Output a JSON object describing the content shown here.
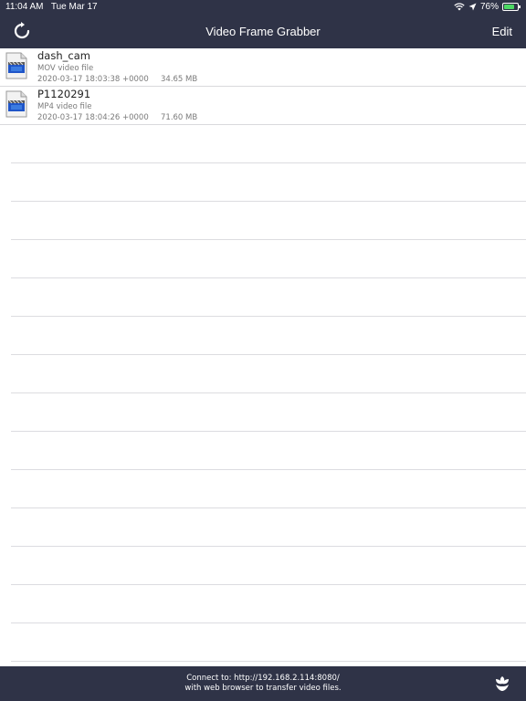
{
  "status": {
    "time": "11:04 AM",
    "date": "Tue Mar 17",
    "battery": "76%",
    "battery_level": 0.76
  },
  "nav": {
    "title": "Video Frame Grabber",
    "edit_label": "Edit"
  },
  "files": [
    {
      "name": "dash_cam",
      "kind": "MOV video file",
      "date": "2020-03-17 18:03:38 +0000",
      "size": "34.65 MB"
    },
    {
      "name": "P1120291",
      "kind": "MP4 video file",
      "date": "2020-03-17 18:04:26 +0000",
      "size": "71.60 MB"
    }
  ],
  "footer": {
    "line1": "Connect to: http://192.168.2.114:8080/",
    "line2": "with web browser to transfer video files."
  },
  "icons": {
    "refresh": "refresh-icon",
    "file": "video-file-icon",
    "flower": "flower-icon",
    "wifi": "wifi-icon",
    "location": "location-icon",
    "battery": "battery-icon"
  },
  "colors": {
    "bar": "#2f3347",
    "separator": "#dcdce0",
    "battery_fill": "#4cd964"
  }
}
